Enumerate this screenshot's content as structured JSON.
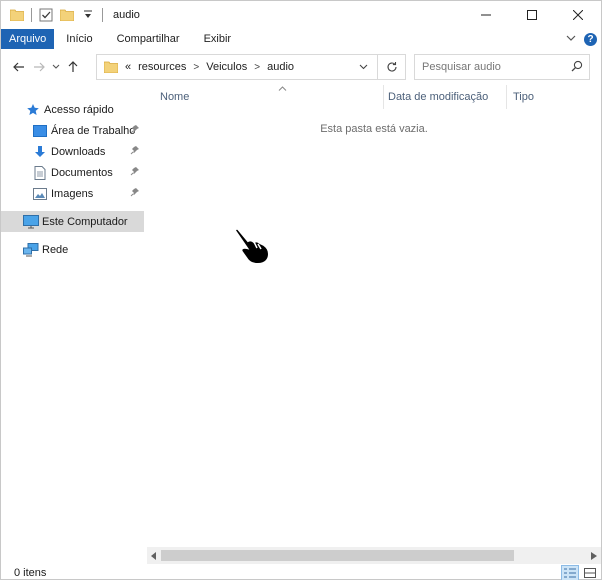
{
  "window": {
    "title": "audio",
    "controls": [
      "minimize",
      "maximize",
      "close"
    ]
  },
  "ribbon": {
    "tabs": [
      {
        "label": "Arquivo",
        "active": true
      },
      {
        "label": "Início"
      },
      {
        "label": "Compartilhar"
      },
      {
        "label": "Exibir"
      }
    ]
  },
  "address": {
    "overflow": "«",
    "crumbs": [
      "resources",
      "Veiculos",
      "audio"
    ]
  },
  "search": {
    "placeholder": "Pesquisar audio"
  },
  "nav": {
    "items": [
      {
        "label": "Acesso rápido",
        "icon": "star-icon"
      },
      {
        "label": "Área de Trabalho",
        "icon": "desktop-folder-icon",
        "pinned": true
      },
      {
        "label": "Downloads",
        "icon": "download-arrow-icon",
        "pinned": true
      },
      {
        "label": "Documentos",
        "icon": "document-icon",
        "pinned": true
      },
      {
        "label": "Imagens",
        "icon": "image-icon",
        "pinned": true
      },
      {
        "label": "Este Computador",
        "icon": "computer-icon",
        "selected": true
      },
      {
        "label": "Rede",
        "icon": "network-icon"
      }
    ]
  },
  "columns": [
    "Nome",
    "Data de modificação",
    "Tipo"
  ],
  "content": {
    "empty_message": "Esta pasta está vazia."
  },
  "status": {
    "item_count": "0 itens"
  },
  "colors": {
    "accent": "#1e64b4",
    "selected_nav": "#d9d9d9",
    "column_header_text": "#4c607a"
  }
}
